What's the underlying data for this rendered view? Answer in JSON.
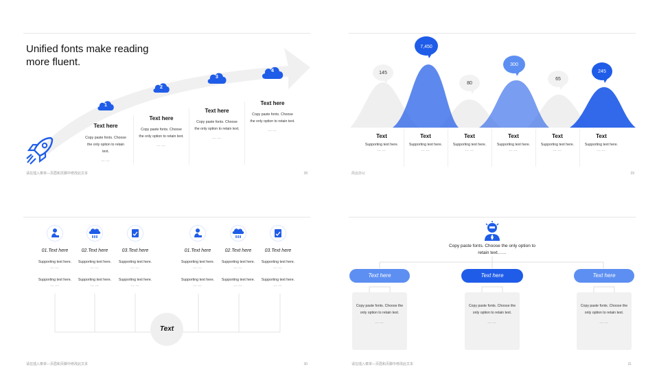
{
  "slide1": {
    "heading": "Unified fonts make reading more fluent.",
    "steps": [
      {
        "num": "1",
        "title": "Text here",
        "body": "Copy paste fonts. Choose the only option to retain text.",
        "dots": "……"
      },
      {
        "num": "2",
        "title": "Text here",
        "body": "Copy paste fonts. Choose the only option to retain text.",
        "dots": "……"
      },
      {
        "num": "3",
        "title": "Text here",
        "body": "Copy paste fonts. Choose the only option to retain text.",
        "dots": "……"
      },
      {
        "num": "4",
        "title": "Text here",
        "body": "Copy paste fonts. Choose the only option to retain text.",
        "dots": "……"
      }
    ],
    "footer": "请在插入菜单—页眉和页脚中修改此文本",
    "page": "28"
  },
  "slide2": {
    "footer": "风云办公",
    "page": "29",
    "columns": [
      {
        "value": "145",
        "title": "Text",
        "sub": "Supporting text here.",
        "dots": "……"
      },
      {
        "value": "7,450",
        "title": "Text",
        "sub": "Supporting text here.",
        "dots": "……"
      },
      {
        "value": "80",
        "title": "Text",
        "sub": "Supporting text here.",
        "dots": "……"
      },
      {
        "value": "300",
        "title": "Text",
        "sub": "Supporting text here.",
        "dots": "……"
      },
      {
        "value": "65",
        "title": "Text",
        "sub": "Supporting text here.",
        "dots": "……"
      },
      {
        "value": "245",
        "title": "Text",
        "sub": "Supporting text here.",
        "dots": "……"
      }
    ]
  },
  "slide3": {
    "footer": "请在插入菜单—页眉和页脚中修改此文本",
    "page": "30",
    "center_label": "Text",
    "items": [
      {
        "title": "01.Text here",
        "sub1": "Supporting text here.",
        "sub2": "Supporting text here.",
        "dots": "……"
      },
      {
        "title": "02.Text here",
        "sub1": "Supporting text here.",
        "sub2": "Supporting text here.",
        "dots": "……"
      },
      {
        "title": "03.Text here",
        "sub1": "Supporting text here.",
        "sub2": "Supporting text here.",
        "dots": "……"
      },
      {
        "title": "01.Text here",
        "sub1": "Supporting text here.",
        "sub2": "Supporting text here.",
        "dots": "……"
      },
      {
        "title": "02.Text here",
        "sub1": "Supporting text here.",
        "sub2": "Supporting text here.",
        "dots": "……"
      },
      {
        "title": "03.Text here",
        "sub1": "Supporting text here.",
        "sub2": "Supporting text here.",
        "dots": "……"
      }
    ]
  },
  "slide4": {
    "footer": "请在插入菜单—页眉和页脚中修改此文本",
    "page": "31",
    "top_text": "Copy paste fonts. Choose the only option to retain text……",
    "branches": [
      {
        "label": "Text here",
        "body": "Copy paste fonts. Choose the only option to retain text.",
        "dots": "……"
      },
      {
        "label": "Text here",
        "body": "Copy paste fonts. Choose the only option to retain text.",
        "dots": "……"
      },
      {
        "label": "Text here",
        "body": "Copy paste fonts. Choose the only option to retain text.",
        "dots": "……"
      }
    ]
  },
  "colors": {
    "primary": "#1f5ce8",
    "primary_light": "#5d8ff2",
    "grey_shape": "#efefef"
  }
}
